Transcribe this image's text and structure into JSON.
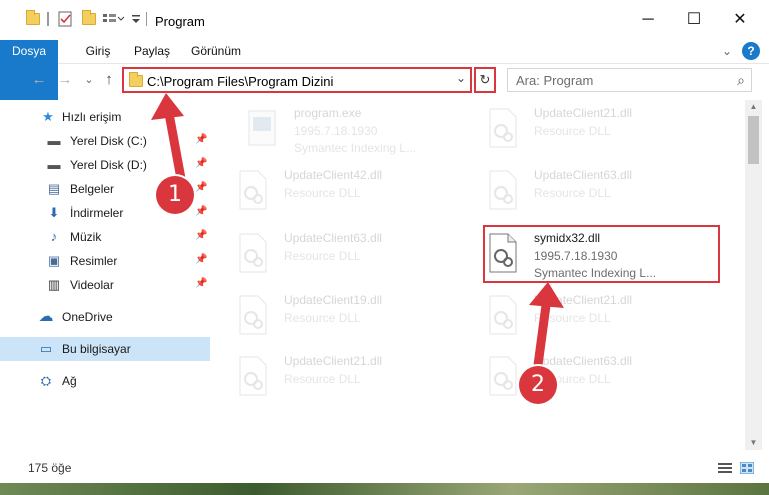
{
  "window": {
    "title": "Program",
    "controls": {
      "minimize": "─",
      "maximize": "☐",
      "close": "✕"
    }
  },
  "ribbon": {
    "tabs": [
      "Dosya",
      "Giriş",
      "Paylaş",
      "Görünüm"
    ],
    "expand_icon": "⌄",
    "help_icon": "?"
  },
  "toolbar": {
    "back": "←",
    "forward": "→",
    "recent": "⌄",
    "up": "↑",
    "address": "C:\\Program Files\\Program Dizini",
    "address_chevron": "⌄",
    "refresh": "↻",
    "search_placeholder": "Ara: Program",
    "search_icon": "⌕"
  },
  "nav": {
    "items": [
      {
        "label": "Hızlı erişim",
        "icon": "star-icon",
        "glyph": "★",
        "pin": ""
      },
      {
        "label": "Yerel Disk (C:)",
        "icon": "drive-icon",
        "glyph": "▬",
        "pin": "📌"
      },
      {
        "label": "Yerel Disk (D:)",
        "icon": "drive-icon",
        "glyph": "▬",
        "pin": "📌"
      },
      {
        "label": "Belgeler",
        "icon": "documents-icon",
        "glyph": "▤",
        "pin": "📌"
      },
      {
        "label": "İndirmeler",
        "icon": "download-icon",
        "glyph": "⬇",
        "pin": "📌"
      },
      {
        "label": "Müzik",
        "icon": "music-icon",
        "glyph": "♪",
        "pin": "📌"
      },
      {
        "label": "Resimler",
        "icon": "pictures-icon",
        "glyph": "▣",
        "pin": "📌"
      },
      {
        "label": "Videolar",
        "icon": "videos-icon",
        "glyph": "▥",
        "pin": "📌"
      },
      {
        "label": "OneDrive",
        "icon": "cloud-icon",
        "glyph": "☁",
        "pin": ""
      },
      {
        "label": "Bu bilgisayar",
        "icon": "computer-icon",
        "glyph": "▭",
        "pin": ""
      },
      {
        "label": "Ağ",
        "icon": "network-icon",
        "glyph": "⛭",
        "pin": ""
      }
    ]
  },
  "files": [
    {
      "name": "program.exe",
      "version": "1995.7.18.1930",
      "description": "Symantec Indexing L..."
    },
    {
      "name": "UpdateClient21.dll",
      "version": "",
      "description": "Resource DLL"
    },
    {
      "name": "UpdateClient42.dll",
      "version": "",
      "description": "Resource DLL"
    },
    {
      "name": "UpdateClient63.dll",
      "version": "",
      "description": "Resource DLL"
    },
    {
      "name": "UpdateClient63.dll",
      "version": "",
      "description": "Resource DLL"
    },
    {
      "name": "symidx32.dll",
      "version": "1995.7.18.1930",
      "description": "Symantec Indexing L..."
    },
    {
      "name": "UpdateClient19.dll",
      "version": "",
      "description": "Resource DLL"
    },
    {
      "name": "UpdateClient21.dll",
      "version": "",
      "description": "Resource DLL"
    },
    {
      "name": "UpdateClient21.dll",
      "version": "",
      "description": "Resource DLL"
    },
    {
      "name": "UpdateClient63.dll",
      "version": "",
      "description": "Resource DLL"
    }
  ],
  "status": {
    "item_count": "175 öğe"
  },
  "annotations": {
    "marker1": "1",
    "marker2": "2",
    "color": "#d9363e"
  }
}
